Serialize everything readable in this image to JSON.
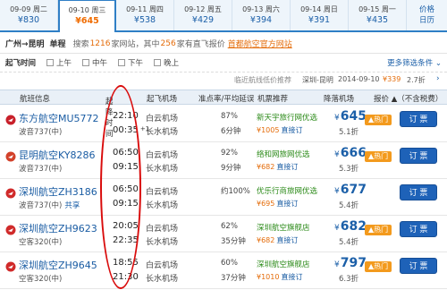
{
  "date_tabs": [
    {
      "date": "09-09 周二",
      "price": "¥830",
      "active": false
    },
    {
      "date": "09-10 周三",
      "price": "¥645",
      "active": true
    },
    {
      "date": "09-11 周四",
      "price": "¥538",
      "active": false
    },
    {
      "date": "09-12 周五",
      "price": "¥429",
      "active": false
    },
    {
      "date": "09-13 周六",
      "price": "¥394",
      "active": false
    },
    {
      "date": "09-14 周日",
      "price": "¥391",
      "active": false
    },
    {
      "date": "09-15 周一",
      "price": "¥435",
      "active": false
    }
  ],
  "calendar": {
    "line1": "价格",
    "line2": "日历"
  },
  "route": {
    "city": "广州→昆明",
    "trip_type": "单程",
    "summary_prefix": "搜索",
    "site_count": "1216",
    "summary_mid": "家网站，其中",
    "direct_count": "256",
    "summary_suffix": "家有直飞报价",
    "official_link": "首都航空官方网站"
  },
  "filter": {
    "title": "起飞时间",
    "options": [
      "上午",
      "中午",
      "下午",
      "晚上"
    ],
    "more": "更多筛选条件 ⌄"
  },
  "info": {
    "lowest_label": "临近航线低价推荐",
    "route": "深圳-昆明",
    "date": "2014-09-10",
    "lowest_price": "¥339",
    "discount": "2.7折"
  },
  "headers": {
    "info": "航班信息",
    "time": "起降时间",
    "sort_icon": "↓",
    "dep_airport": "起飞机场",
    "on_time": "准点率/平均延误",
    "recommend": "机票推荐",
    "arr_airport": "降落机场",
    "price": "报价 ▲（不含税费）"
  },
  "flights": [
    {
      "airline": "东方航空MU5772",
      "aircraft": "波音737(中)",
      "shared": "",
      "logo_color": "#c8202a",
      "dep_time": "22:10",
      "arr_time": "00:35",
      "plus": "+1",
      "dep_airport": "白云机场",
      "arr_airport": "长水机场",
      "rate": "87%",
      "delay": "6分钟",
      "rec_name": "新天宇旅行网优选",
      "rec_off": "",
      "rec_amount": "¥1005",
      "rec_label": "直接订",
      "price": "645",
      "discount": "5.1折",
      "hot": "热门",
      "book": "订 票"
    },
    {
      "airline": "昆明航空KY8286",
      "aircraft": "波音737(中)",
      "shared": "",
      "logo_color": "#d2412a",
      "dep_time": "06:50",
      "arr_time": "09:15",
      "plus": "",
      "dep_airport": "白云机场",
      "arr_airport": "长水机场",
      "rate": "92%",
      "delay": "9分钟",
      "rec_name": "络和网旅网优选",
      "rec_off": "",
      "rec_amount": "¥682",
      "rec_label": "直接订",
      "price": "666",
      "discount": "5.3折",
      "hot": "热门",
      "book": "订 票"
    },
    {
      "airline": "深圳航空ZH3186",
      "aircraft": "波音737(中)",
      "shared": "共享",
      "logo_color": "#d02a2a",
      "dep_time": "06:50",
      "arr_time": "09:15",
      "plus": "",
      "dep_airport": "白云机场",
      "arr_airport": "长水机场",
      "rate": "约100%",
      "delay": "",
      "rec_name": "优乐行商旅网优选",
      "rec_off": "",
      "rec_amount": "¥695",
      "rec_label": "直接订",
      "price": "677",
      "discount": "5.4折",
      "hot": "",
      "book": "订 票"
    },
    {
      "airline": "深圳航空ZH9623",
      "aircraft": "空客320(中)",
      "shared": "",
      "logo_color": "#d02a2a",
      "dep_time": "20:05",
      "arr_time": "22:35",
      "plus": "",
      "dep_airport": "白云机场",
      "arr_airport": "长水机场",
      "rate": "62%",
      "delay": "35分钟",
      "rec_name": "深圳航空旗舰店",
      "rec_off": "",
      "rec_amount": "¥682",
      "rec_label": "直接订",
      "price": "682",
      "discount": "5.4折",
      "hot": "热门",
      "book": "订 票"
    },
    {
      "airline": "深圳航空ZH9645",
      "aircraft": "空客320(中)",
      "shared": "",
      "logo_color": "#d02a2a",
      "dep_time": "18:55",
      "arr_time": "21:30",
      "plus": "",
      "dep_airport": "白云机场",
      "arr_airport": "长水机场",
      "rate": "60%",
      "delay": "37分钟",
      "rec_name": "深圳航空旗舰店",
      "rec_off": "",
      "rec_amount": "¥1010",
      "rec_label": "直接订",
      "price": "797",
      "discount": "6.3折",
      "hot": "热门",
      "book": "订 票"
    }
  ]
}
